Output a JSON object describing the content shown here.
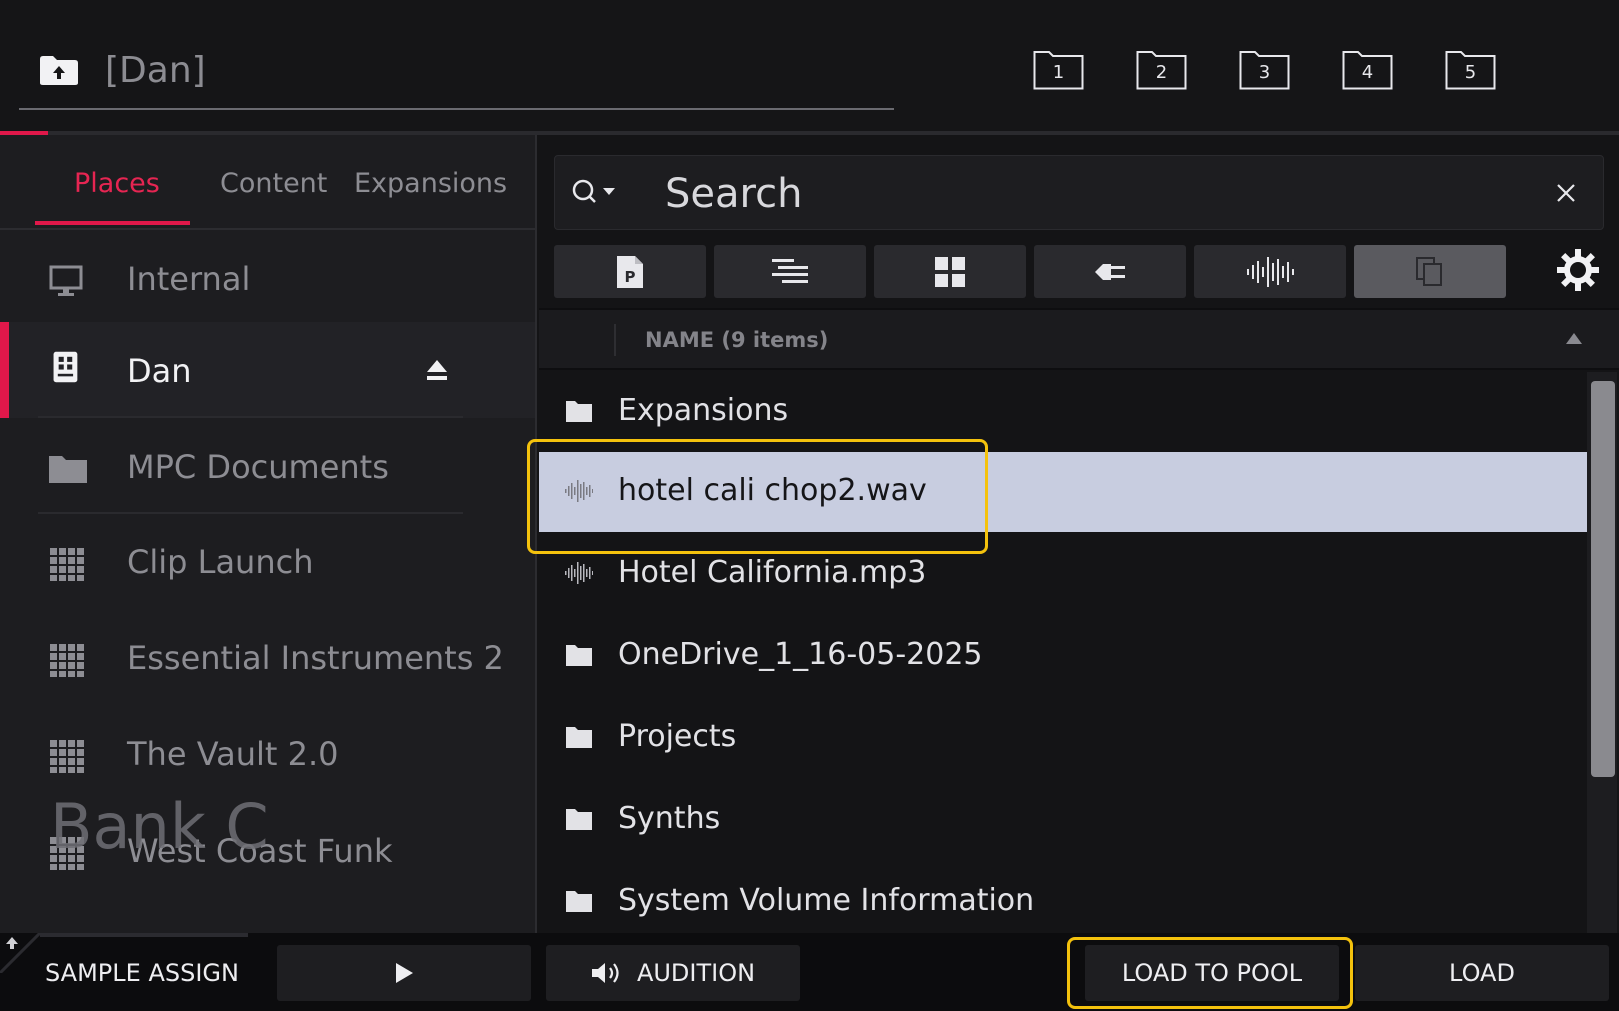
{
  "header": {
    "path": "[Dan]",
    "quick_folders": [
      "1",
      "2",
      "3",
      "4",
      "5"
    ]
  },
  "left": {
    "tabs": [
      "Places",
      "Content",
      "Expansions"
    ],
    "active_tab": "Places",
    "places": [
      {
        "label": "Internal",
        "icon": "monitor-icon"
      },
      {
        "label": "Dan",
        "icon": "drive-icon",
        "selected": true
      },
      {
        "label": "MPC Documents",
        "icon": "folder-icon"
      },
      {
        "label": "Clip Launch",
        "icon": "grid-icon"
      },
      {
        "label": "Essential Instruments 2",
        "icon": "grid-icon"
      },
      {
        "label": "The Vault 2.0",
        "icon": "grid-icon"
      },
      {
        "label": "West Coast Funk",
        "icon": "grid-icon"
      }
    ],
    "bank_overlay": "Bank C"
  },
  "search": {
    "placeholder": "Search"
  },
  "list": {
    "header": "NAME (9 items)",
    "rows": [
      {
        "label": "Expansions",
        "icon": "folder-icon"
      },
      {
        "label": "hotel cali chop2.wav",
        "icon": "waveform-icon",
        "selected": true
      },
      {
        "label": "Hotel California.mp3",
        "icon": "waveform-icon"
      },
      {
        "label": "OneDrive_1_16-05-2025",
        "icon": "folder-icon"
      },
      {
        "label": "Projects",
        "icon": "folder-icon"
      },
      {
        "label": "Synths",
        "icon": "folder-icon"
      },
      {
        "label": "System Volume Information",
        "icon": "folder-icon"
      }
    ]
  },
  "footer": {
    "mode": "SAMPLE ASSIGN",
    "audition": "AUDITION",
    "load_to_pool": "LOAD TO POOL",
    "load": "LOAD"
  },
  "colors": {
    "accent": "#e0184a",
    "highlight": "#f4c20d",
    "selected_row": "#c8cde0"
  }
}
